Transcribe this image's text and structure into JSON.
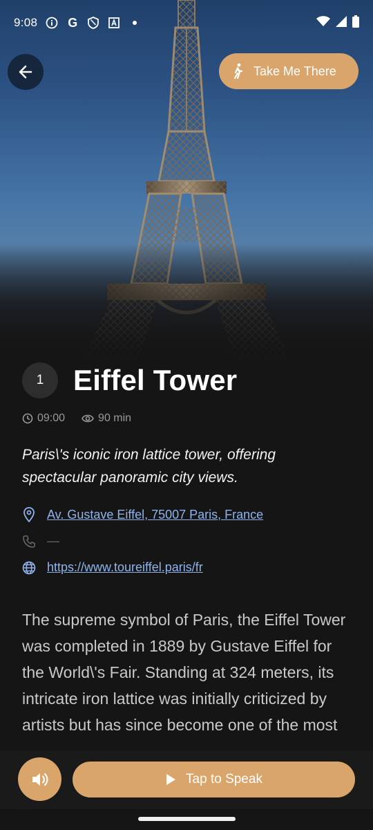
{
  "status_bar": {
    "time": "9:08",
    "left_icons": [
      "info-circle-icon",
      "google-g-icon",
      "shield-icon",
      "a-box-icon",
      "dot-icon"
    ],
    "right_icons": [
      "wifi-icon",
      "signal-icon",
      "battery-icon"
    ]
  },
  "header": {
    "back_icon": "arrow-left-icon",
    "take_me_there_label": "Take Me There",
    "walk_icon": "walking-person-icon"
  },
  "place": {
    "number": "1",
    "name": "Eiffel Tower",
    "time": "09:00",
    "duration": "90 min",
    "tagline": "Paris\\'s iconic iron lattice tower, offering spectacular panoramic city views.",
    "address": "Av. Gustave Eiffel, 75007 Paris, France",
    "phone": "—",
    "website": "https://www.toureiffel.paris/fr",
    "description": "The supreme symbol of Paris, the Eiffel Tower was completed in 1889 by Gustave Eiffel for the World\\'s Fair. Standing at 324 meters, its intricate iron lattice was initially criticized by artists but has since become one of the most"
  },
  "bottom": {
    "sound_icon": "speaker-icon",
    "speak_label": "Tap to Speak",
    "play_icon": "play-icon"
  },
  "colors": {
    "accent": "#d9a56a",
    "background": "#151515",
    "link": "#8fb4ec",
    "muted": "#9a9a9a"
  }
}
